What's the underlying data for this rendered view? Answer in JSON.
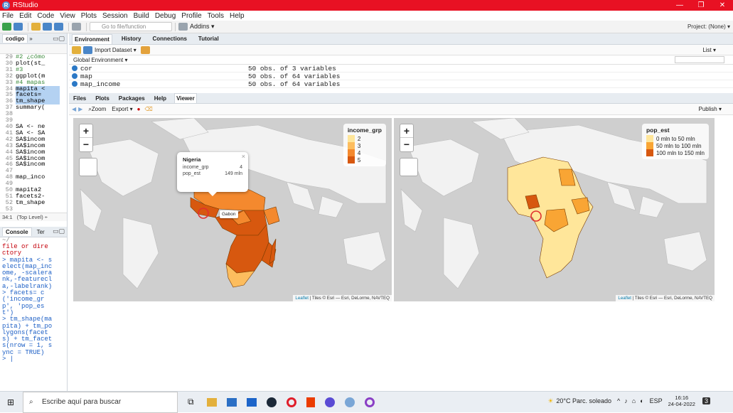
{
  "window": {
    "title": "RStudio",
    "controls": [
      "—",
      "❐",
      "✕"
    ]
  },
  "menu": [
    "File",
    "Edit",
    "Code",
    "View",
    "Plots",
    "Session",
    "Build",
    "Debug",
    "Profile",
    "Tools",
    "Help"
  ],
  "toolbar": {
    "goto_placeholder": "Go to file/function",
    "addins": "Addins ▾",
    "project": "Project: (None) ▾"
  },
  "editor": {
    "tab": "codigo",
    "lines": [
      {
        "n": "29",
        "t": "#2 ¿cómo",
        "c": true
      },
      {
        "n": "30",
        "t": "plot(st_"
      },
      {
        "n": "31",
        "t": "#3",
        "c": true
      },
      {
        "n": "32",
        "t": "ggplot(m"
      },
      {
        "n": "33",
        "t": "#4 mapas",
        "c": true
      },
      {
        "n": "34",
        "t": "mapita <",
        "h": true
      },
      {
        "n": "35",
        "t": "facets=",
        "h": true
      },
      {
        "n": "36",
        "t": "tm_shape",
        "h": true
      },
      {
        "n": "37",
        "t": "summary("
      },
      {
        "n": "38",
        "t": ""
      },
      {
        "n": "39",
        "t": ""
      },
      {
        "n": "40",
        "t": "SA <- ne"
      },
      {
        "n": "41",
        "t": "SA <- SA"
      },
      {
        "n": "42",
        "t": "SA$incom"
      },
      {
        "n": "43",
        "t": "SA$incom"
      },
      {
        "n": "44",
        "t": "SA$incom"
      },
      {
        "n": "45",
        "t": "SA$incom"
      },
      {
        "n": "46",
        "t": "SA$incom"
      },
      {
        "n": "47",
        "t": ""
      },
      {
        "n": "48",
        "t": "map_inco"
      },
      {
        "n": "49",
        "t": ""
      },
      {
        "n": "50",
        "t": "mapita2"
      },
      {
        "n": "51",
        "t": "facets2-"
      },
      {
        "n": "52",
        "t": "tm_shape"
      },
      {
        "n": "53",
        "t": ""
      }
    ],
    "status_pos": "34:1",
    "status_level": "(Top Level) ÷"
  },
  "console": {
    "tabs": [
      "Console",
      "Ter"
    ],
    "path": "~/",
    "lines": [
      {
        "t": " file or dire",
        "e": true
      },
      {
        "t": "ctory",
        "e": true
      },
      {
        "t": "> mapita <- s"
      },
      {
        "t": "elect(map_inc"
      },
      {
        "t": "ome, -scalera"
      },
      {
        "t": "nk,-featurecl"
      },
      {
        "t": "a,-labelrank)"
      },
      {
        "t": "> facets= c"
      },
      {
        "t": "('income_gr"
      },
      {
        "t": "p', 'pop_es"
      },
      {
        "t": "t')"
      },
      {
        "t": "> tm_shape(ma"
      },
      {
        "t": "pita) + tm_po"
      },
      {
        "t": "lygons(facet"
      },
      {
        "t": "s) + tm_facet"
      },
      {
        "t": "s(nrow = 1, s"
      },
      {
        "t": "ync = TRUE)"
      },
      {
        "t": "> |"
      }
    ]
  },
  "environment": {
    "tabs": [
      "Environment",
      "History",
      "Connections",
      "Tutorial"
    ],
    "import": "Import Dataset ▾",
    "list_view": "List ▾",
    "scope": "Global Environment ▾",
    "rows": [
      {
        "name": "cor",
        "value": "50 obs. of 3 variables"
      },
      {
        "name": "map",
        "value": "50 obs. of 64 variables"
      },
      {
        "name": "map_income",
        "value": "50 obs. of 64 variables"
      }
    ]
  },
  "viewer": {
    "tabs": [
      "Files",
      "Plots",
      "Packages",
      "Help",
      "Viewer"
    ],
    "zoom": "Zoom",
    "export": "Export ▾",
    "publish": "Publish ▾",
    "attribution_link": "Leaflet",
    "attribution_text": " | Tiles © Esri — Esri, DeLorme, NAVTEQ"
  },
  "map_left": {
    "legend_title": "income_grp",
    "legend": [
      {
        "label": "2",
        "color": "#ffe69a"
      },
      {
        "label": "3",
        "color": "#fdbd5e"
      },
      {
        "label": "4",
        "color": "#f4892e"
      },
      {
        "label": "5",
        "color": "#d7580f"
      }
    ],
    "popup_title": "Nigeria",
    "popup_rows": [
      {
        "k": "income_grp",
        "v": "4"
      },
      {
        "k": "pop_est",
        "v": "149 mln"
      }
    ],
    "hover_label": "Gabon"
  },
  "map_right": {
    "legend_title": "pop_est",
    "legend": [
      {
        "label": "0 mln to 50 mln",
        "color": "#ffe69a"
      },
      {
        "label": "50 mln to 100 mln",
        "color": "#f9a534"
      },
      {
        "label": "100 mln to 150 mln",
        "color": "#d7580f"
      }
    ]
  },
  "taskbar": {
    "search_placeholder": "Escribe aquí para buscar",
    "weather": "20°C  Parc. soleado",
    "lang": "ESP",
    "time": "16:16",
    "date": "24-04-2022",
    "notif": "3"
  }
}
